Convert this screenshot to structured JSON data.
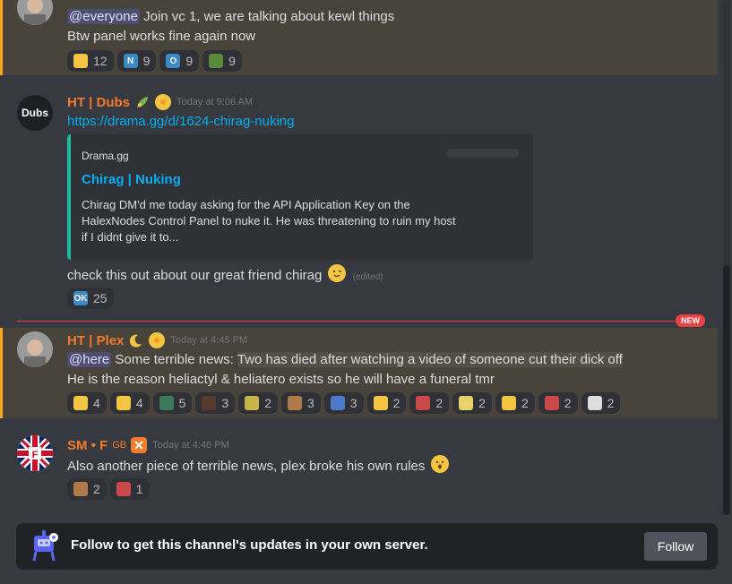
{
  "messages": [
    {
      "id": "plex-1",
      "line1_mention": "@everyone",
      "line1_text": " Join vc 1, we are talking about kewl things",
      "line2_text": "Btw panel works fine again now",
      "reactions": [
        {
          "icon": "unamused-emoji",
          "count": "12",
          "glyph": "",
          "color": "#f4c542"
        },
        {
          "icon": "letter-n-emoji",
          "count": "9",
          "glyph": "N",
          "color": "#3b88c3"
        },
        {
          "icon": "letter-o-emoji",
          "count": "9",
          "glyph": "O",
          "color": "#3b88c3"
        },
        {
          "icon": "custom-emoji",
          "count": "9",
          "glyph": "",
          "color": "#5a8a3a"
        }
      ]
    },
    {
      "id": "dubs",
      "avatar_text": "Dubs",
      "author": "HT | Dubs",
      "timestamp": "Today at 9:06 AM",
      "link": "https://drama.gg/d/1624-chirag-nuking",
      "embed": {
        "provider": "Drama.gg",
        "title": "Chirag | Nuking",
        "description": "Chirag DM'd me today asking for the API Application Key on the HalexNodes Control Panel to nuke it. He was threatening to ruin my host if I didnt give it to..."
      },
      "text": "check this out about our great friend chirag",
      "edited": "(edited)",
      "reactions": [
        {
          "icon": "ok-button-emoji",
          "count": "25",
          "glyph": "OK",
          "color": "#3b88c3"
        }
      ]
    },
    {
      "id": "plex-2",
      "author": "HT | Plex",
      "timestamp": "Today at 4:45 PM",
      "line1_mention": "@here",
      "line1_text": " Some terrible news: ",
      "line1_quoted": "Two has died after watching a video of someone cut their dick off",
      "line2_text": "He is the reason heliactyl & heliatero exists so he will have a funeral tmr",
      "reactions": [
        {
          "icon": "loudly-crying-emoji",
          "count": "4",
          "color": "#f4c542"
        },
        {
          "icon": "yum-emoji",
          "count": "4",
          "color": "#f4c542"
        },
        {
          "icon": "custom-emoji",
          "count": "5",
          "color": "#3a7a5a"
        },
        {
          "icon": "custom-emoji",
          "count": "3",
          "color": "#5a3a2a"
        },
        {
          "icon": "custom-emoji",
          "count": "2",
          "color": "#c9b44a"
        },
        {
          "icon": "custom-emoji",
          "count": "3",
          "color": "#b07a4a"
        },
        {
          "icon": "custom-emoji",
          "count": "3",
          "color": "#4a7ac9"
        },
        {
          "icon": "sunglasses-emoji",
          "count": "2",
          "color": "#f4c542"
        },
        {
          "icon": "custom-emoji",
          "count": "2",
          "color": "#c94a4a"
        },
        {
          "icon": "custom-emoji",
          "count": "2",
          "color": "#e8d06a"
        },
        {
          "icon": "rofl-emoji",
          "count": "2",
          "color": "#f4c542"
        },
        {
          "icon": "custom-emoji",
          "count": "2",
          "color": "#c94a4a"
        },
        {
          "icon": "trollface-emoji",
          "count": "2",
          "color": "#dddddd"
        }
      ]
    },
    {
      "id": "sm",
      "author": "SM • F",
      "author_tag": "GB",
      "timestamp": "Today at 4:46 PM",
      "text": "Also another piece of terrible news, plex broke his own rules",
      "reactions": [
        {
          "icon": "custom-emoji",
          "count": "2",
          "color": "#b07a4a"
        },
        {
          "icon": "custom-emoji",
          "count": "1",
          "color": "#c94a4a"
        }
      ]
    }
  ],
  "new_marker": "NEW",
  "follow": {
    "text": "Follow to get this channel's updates in your own server.",
    "button": "Follow"
  },
  "colors": {
    "author_orange": "#f47b2a",
    "mention_highlight": "#faa81a",
    "link": "#00aff4",
    "embed_accent": "#1abc9c"
  }
}
